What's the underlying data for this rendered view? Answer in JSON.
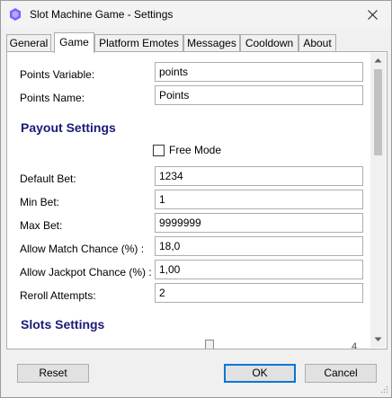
{
  "window": {
    "title": "Slot Machine Game - Settings",
    "app_icon": "streamer-bot-icon",
    "close_icon": "close-icon"
  },
  "tabs": [
    {
      "label": "General",
      "active": false
    },
    {
      "label": "Game",
      "active": true
    },
    {
      "label": "Platform Emotes",
      "active": false
    },
    {
      "label": "Messages",
      "active": false
    },
    {
      "label": "Cooldown",
      "active": false
    },
    {
      "label": "About",
      "active": false
    }
  ],
  "game": {
    "points_variable": {
      "label": "Points Variable:",
      "value": "points"
    },
    "points_name": {
      "label": "Points Name:",
      "value": "Points"
    },
    "payout_section": "Payout Settings",
    "free_mode": {
      "label": "Free Mode",
      "checked": false
    },
    "default_bet": {
      "label": "Default Bet:",
      "value": "1234"
    },
    "min_bet": {
      "label": "Min Bet:",
      "value": "1"
    },
    "max_bet": {
      "label": "Max Bet:",
      "value": "9999999"
    },
    "allow_match_chance": {
      "label": "Allow Match Chance (%) :",
      "value": "18,0"
    },
    "allow_jackpot_chance": {
      "label": "Allow Jackpot Chance (%) :",
      "value": "1,00"
    },
    "reroll_attempts": {
      "label": "Reroll Attempts:",
      "value": "2"
    },
    "slots_section": "Slots Settings",
    "slots_slider": {
      "value_label": "4"
    }
  },
  "buttons": {
    "reset": "Reset",
    "ok": "OK",
    "cancel": "Cancel"
  },
  "colors": {
    "section_title": "#1a1a78",
    "default_button_border": "#0078d7",
    "icon_purple": "#7b61ff"
  }
}
